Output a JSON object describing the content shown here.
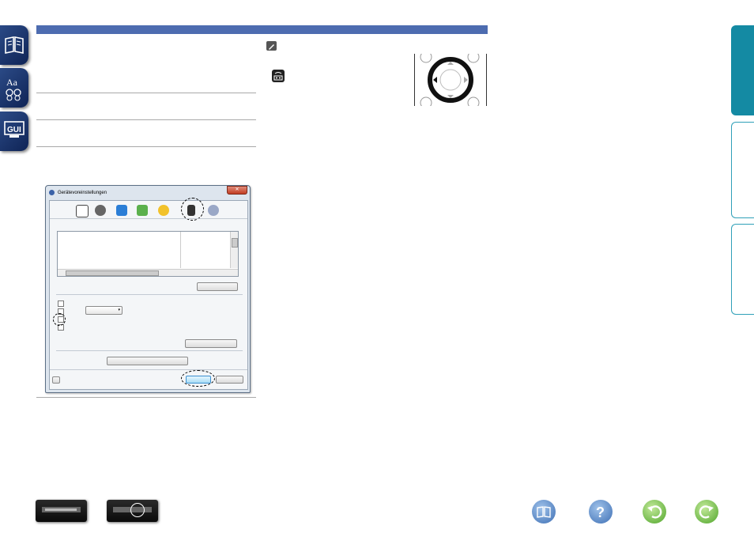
{
  "window": {
    "title": "Gerätevoreinstellungen",
    "close_label": "✕"
  },
  "colors": {
    "header_bar": "#4d6cb0",
    "side_tab_active": "#148aa3",
    "side_tab": "#1e98b3"
  },
  "icons": {
    "left_tabs": [
      "book-icon",
      "glossary-icon",
      "gui-icon"
    ],
    "bottom": [
      "manual-icon",
      "help-icon",
      "back-icon",
      "forward-icon"
    ],
    "note": "pencil-icon",
    "remote": "remote-control-icon"
  }
}
